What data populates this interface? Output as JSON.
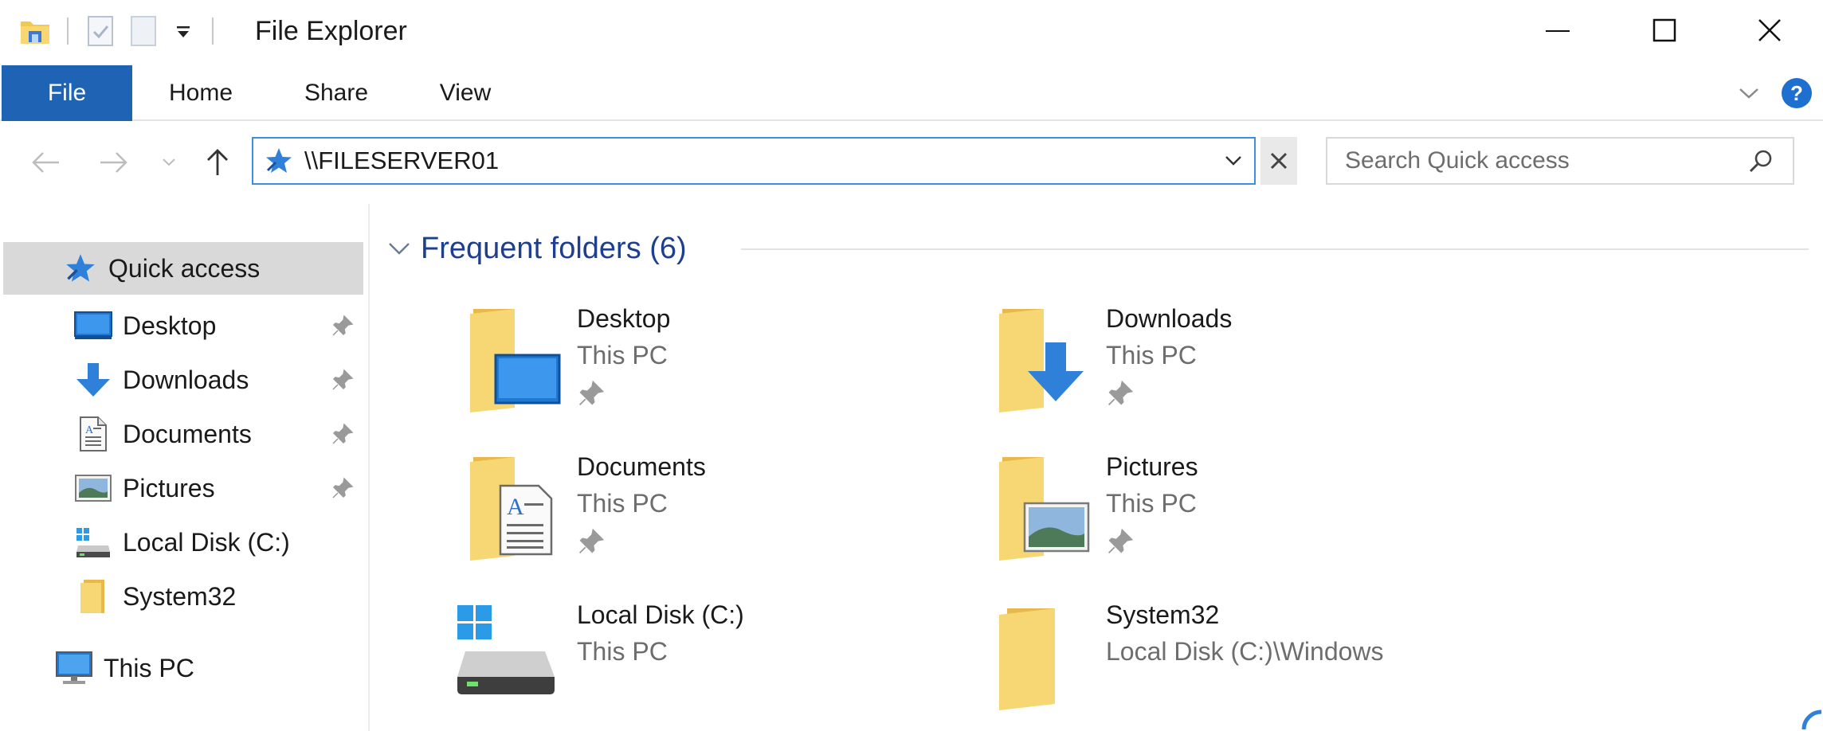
{
  "window": {
    "title": "File Explorer"
  },
  "ribbon": {
    "tabs": [
      {
        "label": "File",
        "active": true
      },
      {
        "label": "Home"
      },
      {
        "label": "Share"
      },
      {
        "label": "View"
      }
    ]
  },
  "address": {
    "path": "\\\\FILESERVER01"
  },
  "search": {
    "placeholder": "Search Quick access"
  },
  "navpane": {
    "quick_access": "Quick access",
    "items": [
      {
        "label": "Desktop",
        "icon": "desktop-icon",
        "pinned": true
      },
      {
        "label": "Downloads",
        "icon": "download-arrow-icon",
        "pinned": true
      },
      {
        "label": "Documents",
        "icon": "document-icon",
        "pinned": true
      },
      {
        "label": "Pictures",
        "icon": "pictures-icon",
        "pinned": true
      },
      {
        "label": "Local Disk (C:)",
        "icon": "drive-icon",
        "pinned": false
      },
      {
        "label": "System32",
        "icon": "folder-icon",
        "pinned": false
      }
    ],
    "this_pc": "This PC"
  },
  "content": {
    "group_title": "Frequent folders (6)",
    "tiles": [
      {
        "name": "Desktop",
        "location": "This PC",
        "pinned": true,
        "icon": "desktop-folder-icon"
      },
      {
        "name": "Downloads",
        "location": "This PC",
        "pinned": true,
        "icon": "downloads-folder-icon"
      },
      {
        "name": "Documents",
        "location": "This PC",
        "pinned": true,
        "icon": "documents-folder-icon"
      },
      {
        "name": "Pictures",
        "location": "This PC",
        "pinned": true,
        "icon": "pictures-folder-icon"
      },
      {
        "name": "Local Disk (C:)",
        "location": "This PC",
        "pinned": false,
        "icon": "local-disk-icon"
      },
      {
        "name": "System32",
        "location": "Local Disk (C:)\\Windows",
        "pinned": false,
        "icon": "system32-folder-icon"
      }
    ]
  },
  "colors": {
    "file_tab": "#1e63b4",
    "group_title": "#1e3f8f",
    "address_border": "#3c8fde",
    "selection": "#d9d9d9",
    "folder": "#f2cf62"
  }
}
